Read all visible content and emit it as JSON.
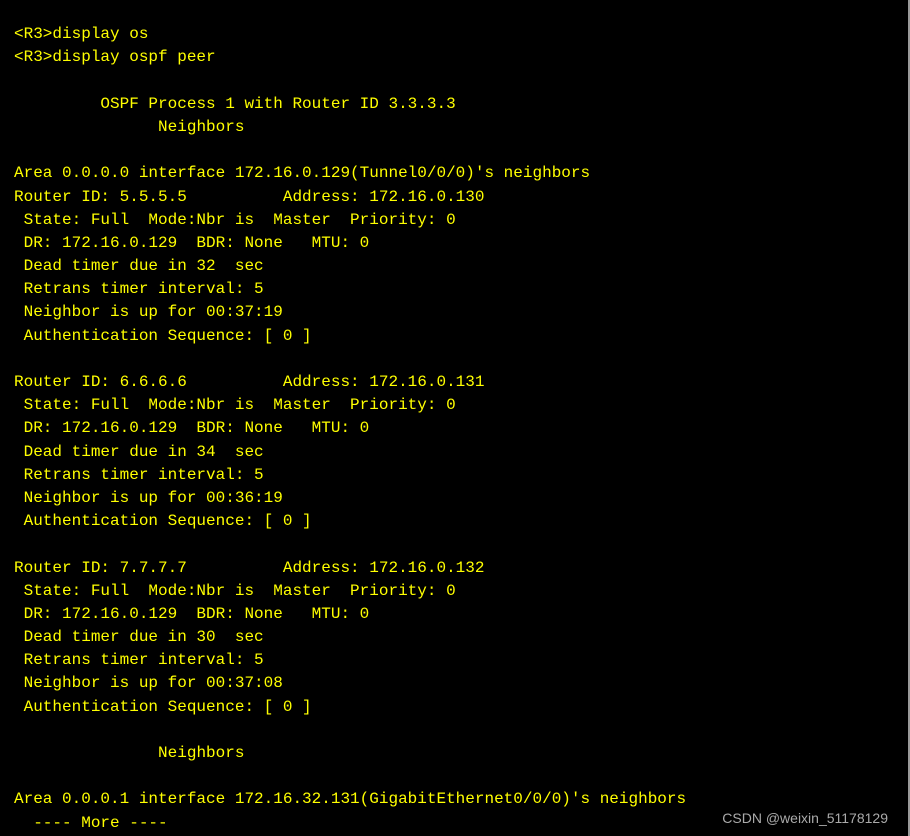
{
  "prompt": "<R3>",
  "commands": {
    "line1": "display os",
    "line2": "display ospf peer"
  },
  "header": {
    "process_line": "OSPF Process 1 with Router ID 3.3.3.3",
    "neighbors_label": "Neighbors"
  },
  "area0": {
    "header": "Area 0.0.0.0 interface 172.16.0.129(Tunnel0/0/0)'s neighbors",
    "peers": [
      {
        "router_id_line": "Router ID: 5.5.5.5          Address: 172.16.0.130",
        "state_line": " State: Full  Mode:Nbr is  Master  Priority: 0",
        "dr_line": " DR: 172.16.0.129  BDR: None   MTU: 0",
        "dead_line": " Dead timer due in 32  sec",
        "retrans_line": " Retrans timer interval: 5",
        "up_line": " Neighbor is up for 00:37:19",
        "auth_line": " Authentication Sequence: [ 0 ]"
      },
      {
        "router_id_line": "Router ID: 6.6.6.6          Address: 172.16.0.131",
        "state_line": " State: Full  Mode:Nbr is  Master  Priority: 0",
        "dr_line": " DR: 172.16.0.129  BDR: None   MTU: 0",
        "dead_line": " Dead timer due in 34  sec",
        "retrans_line": " Retrans timer interval: 5",
        "up_line": " Neighbor is up for 00:36:19",
        "auth_line": " Authentication Sequence: [ 0 ]"
      },
      {
        "router_id_line": "Router ID: 7.7.7.7          Address: 172.16.0.132",
        "state_line": " State: Full  Mode:Nbr is  Master  Priority: 0",
        "dr_line": " DR: 172.16.0.129  BDR: None   MTU: 0",
        "dead_line": " Dead timer due in 30  sec",
        "retrans_line": " Retrans timer interval: 5",
        "up_line": " Neighbor is up for 00:37:08",
        "auth_line": " Authentication Sequence: [ 0 ]"
      }
    ]
  },
  "neighbors_label2": "Neighbors",
  "area1": {
    "header": "Area 0.0.0.1 interface 172.16.32.131(GigabitEthernet0/0/0)'s neighbors"
  },
  "more_prompt": "  ---- More ----",
  "watermark": "CSDN @weixin_51178129"
}
